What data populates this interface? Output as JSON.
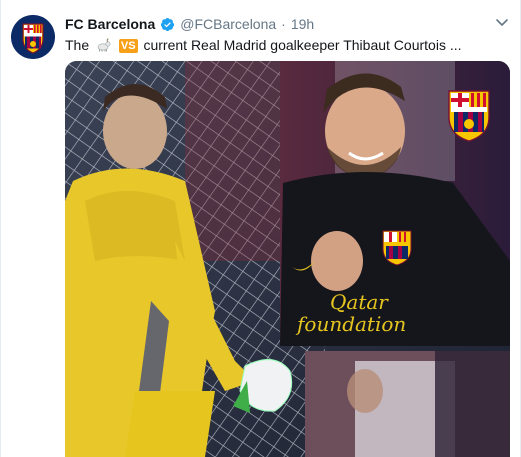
{
  "tweet": {
    "display_name": "FC Barcelona",
    "handle": "@FCBarcelona",
    "separator": "·",
    "time": "19h",
    "text_before": "The",
    "vs_badge": "VS",
    "text_after": "current Real Madrid goalkeeper Thibaut Courtois ...",
    "icons": [
      "verified-badge-icon",
      "goat-emoji-icon",
      "chevron-down-icon"
    ]
  },
  "media": {
    "shirt_sponsor_line1": "Qatar",
    "shirt_sponsor_line2": "foundation"
  },
  "colors": {
    "verified_blue": "#1da1f2",
    "muted_text": "#657786",
    "vs_orange": "#f7a11a",
    "barca_blue": "#0b2a66",
    "barca_red": "#a50044"
  }
}
